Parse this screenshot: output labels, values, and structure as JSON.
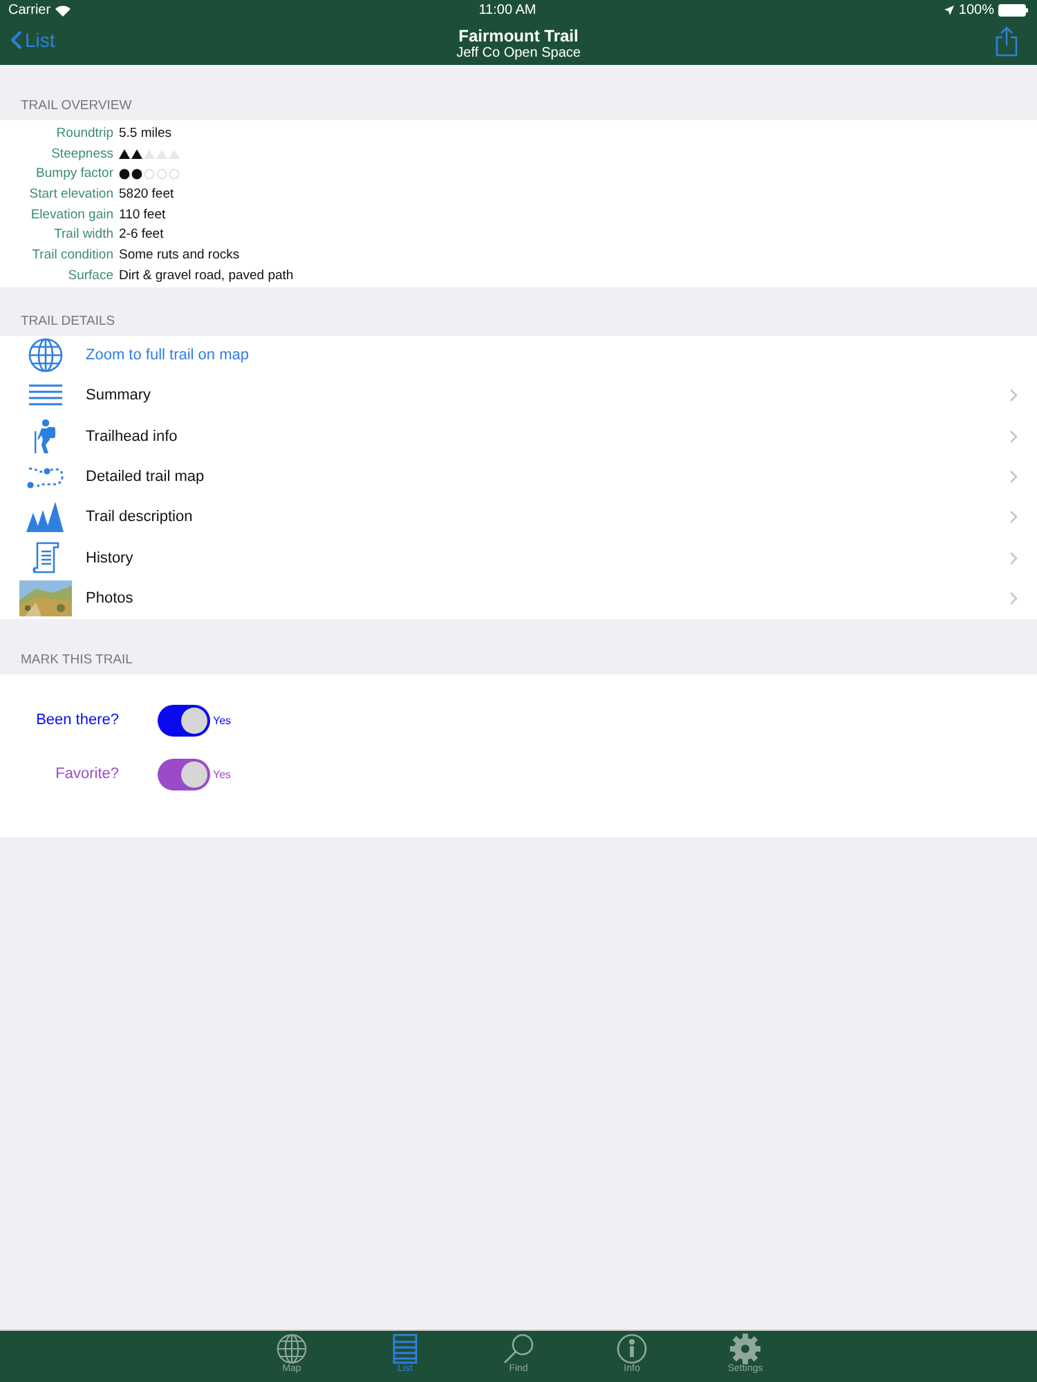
{
  "status_bar": {
    "carrier": "Carrier",
    "time": "11:00 AM",
    "battery": "100%"
  },
  "nav": {
    "back": "List",
    "title": "Fairmount Trail",
    "subtitle": "Jeff Co Open Space"
  },
  "overview": {
    "header": "TRAIL OVERVIEW",
    "rows": [
      {
        "kind": "text",
        "label": "Roundtrip",
        "value": "5.5 miles"
      },
      {
        "kind": "triangles",
        "label": "Steepness",
        "stars": 2
      },
      {
        "kind": "dots",
        "label": "Bumpy factor",
        "stars": 2
      },
      {
        "kind": "text",
        "label": "Start elevation",
        "value": "5820 feet"
      },
      {
        "kind": "text",
        "label": "Elevation gain",
        "value": "110 feet"
      },
      {
        "kind": "text",
        "label": "Trail width",
        "value": "2-6 feet"
      },
      {
        "kind": "text",
        "label": "Trail condition",
        "value": "Some ruts and rocks"
      },
      {
        "kind": "text",
        "label": "Surface",
        "value": "Dirt & gravel road, paved path"
      }
    ]
  },
  "details": {
    "header": "TRAIL DETAILS",
    "items": [
      {
        "kind": "globe",
        "label": "Zoom to full trail on map",
        "link": true
      },
      {
        "kind": "lines",
        "label": "Summary",
        "link": false
      },
      {
        "kind": "hiker",
        "label": "Trailhead info",
        "link": false
      },
      {
        "kind": "route",
        "label": "Detailed trail map",
        "link": false
      },
      {
        "kind": "trees",
        "label": "Trail description",
        "link": false
      },
      {
        "kind": "scroll",
        "label": "History",
        "link": false
      },
      {
        "label": "Photos",
        "link": false
      }
    ]
  },
  "mark": {
    "header": "MARK THIS TRAIL",
    "toggles": [
      {
        "label": "Been there?",
        "on": true,
        "color": "#0a0af0",
        "state": "Yes"
      },
      {
        "label": "Favorite?",
        "on": true,
        "color": "#9a4cc8",
        "state": "Yes"
      }
    ]
  },
  "tab_bar": [
    {
      "kind": "map",
      "label": "Map",
      "selected": false
    },
    {
      "kind": "list",
      "label": "List",
      "selected": true
    },
    {
      "kind": "find",
      "label": "Find",
      "selected": false
    },
    {
      "kind": "info",
      "label": "Info",
      "selected": false
    },
    {
      "kind": "settings",
      "label": "Settings",
      "selected": false
    }
  ]
}
